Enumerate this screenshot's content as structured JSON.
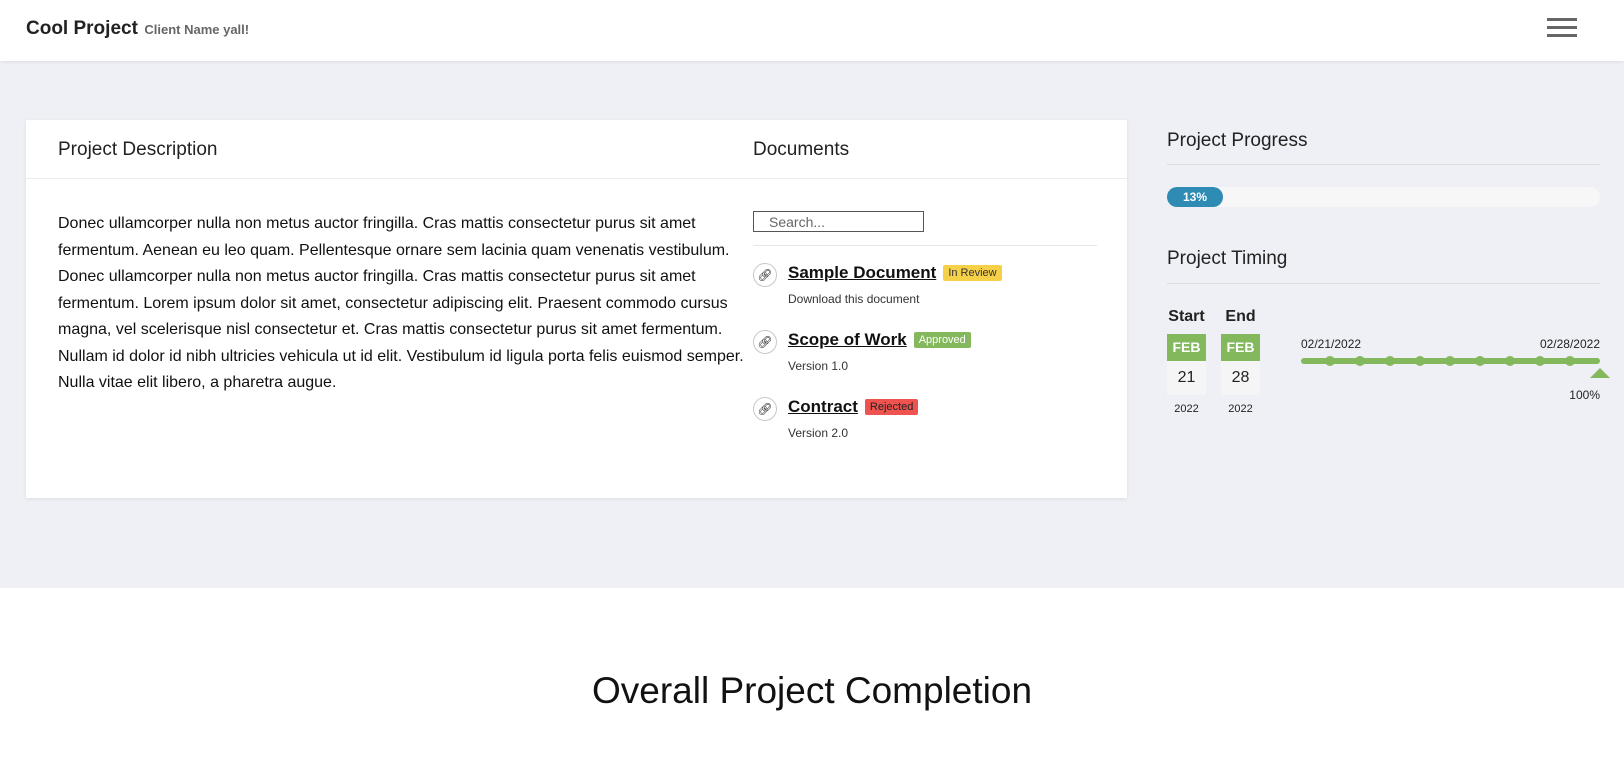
{
  "header": {
    "title": "Cool Project",
    "client": "Client Name yall!",
    "menu_icon": "hamburger-icon"
  },
  "description": {
    "heading": "Project Description",
    "text": "Donec ullamcorper nulla non metus auctor fringilla. Cras mattis consectetur purus sit amet fermentum. Aenean eu leo quam. Pellentesque ornare sem lacinia quam venenatis vestibulum. Donec ullamcorper nulla non metus auctor fringilla. Cras mattis consectetur purus sit amet fermentum. Lorem ipsum dolor sit amet, consectetur adipiscing elit. Praesent commodo cursus magna, vel scelerisque nisl consectetur et. Cras mattis consectetur purus sit amet fermentum. Nullam id dolor id nibh ultricies vehicula ut id elit. Vestibulum id ligula porta felis euismod semper. Nulla vitae elit libero, a pharetra augue."
  },
  "documents": {
    "heading": "Documents",
    "search_placeholder": "Search...",
    "items": [
      {
        "title": "Sample Document",
        "status": "In Review",
        "status_color": "#f6d047",
        "status_text_color": "#333333",
        "subtitle": "Download this document",
        "icon": "link-icon"
      },
      {
        "title": "Scope of Work",
        "status": "Approved",
        "status_color": "#84b85c",
        "status_text_color": "#ffffff",
        "subtitle": "Version 1.0",
        "icon": "link-icon"
      },
      {
        "title": "Contract",
        "status": "Rejected",
        "status_color": "#ef5350",
        "status_text_color": "#222222",
        "subtitle": "Version 2.0",
        "icon": "link-icon"
      }
    ]
  },
  "progress": {
    "heading": "Project Progress",
    "percent_label": "13%",
    "value": 0.13,
    "bar_color": "#2e8bb3"
  },
  "timing": {
    "heading": "Project Timing",
    "start": {
      "label": "Start",
      "month": "FEB",
      "day": "21",
      "year": "2022"
    },
    "end": {
      "label": "End",
      "month": "FEB",
      "day": "28",
      "year": "2022"
    },
    "timeline_start": "02/21/2022",
    "timeline_end": "02/28/2022",
    "timeline_percent": "100%",
    "timeline_value": 1.0,
    "accent_color": "#84b85c"
  },
  "completion": {
    "heading": "Overall Project Completion"
  }
}
